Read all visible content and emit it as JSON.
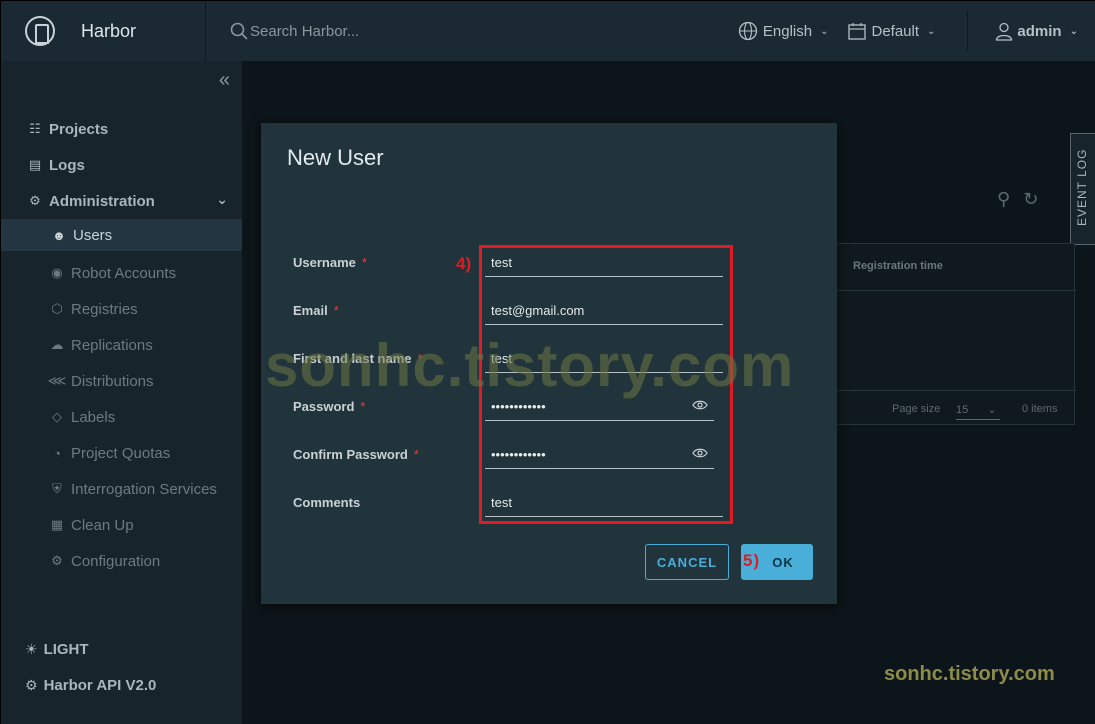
{
  "header": {
    "brand": "Harbor",
    "search_placeholder": "Search Harbor...",
    "language": "English",
    "theme_scope": "Default",
    "user": "admin"
  },
  "sidebar": {
    "items": [
      {
        "label": "Projects",
        "icon": "projects-icon",
        "level": "top"
      },
      {
        "label": "Logs",
        "icon": "logs-icon",
        "level": "top"
      },
      {
        "label": "Administration",
        "icon": "administration-icon",
        "level": "top"
      },
      {
        "label": "Users",
        "icon": "users-icon",
        "level": "sub",
        "active": true
      },
      {
        "label": "Robot Accounts",
        "icon": "robot-icon",
        "level": "sub"
      },
      {
        "label": "Registries",
        "icon": "registries-icon",
        "level": "sub"
      },
      {
        "label": "Replications",
        "icon": "replications-icon",
        "level": "sub"
      },
      {
        "label": "Distributions",
        "icon": "distributions-icon",
        "level": "sub"
      },
      {
        "label": "Labels",
        "icon": "labels-icon",
        "level": "sub"
      },
      {
        "label": "Project Quotas",
        "icon": "quotas-icon",
        "level": "sub"
      },
      {
        "label": "Interrogation Services",
        "icon": "shield-icon",
        "level": "sub"
      },
      {
        "label": "Clean Up",
        "icon": "trash-icon",
        "level": "sub"
      },
      {
        "label": "Configuration",
        "icon": "gear-icon",
        "level": "sub"
      }
    ],
    "theme_toggle": "LIGHT",
    "api_link": "Harbor API V2.0"
  },
  "background": {
    "event_log": "EVENT LOG",
    "table_header": "Registration time",
    "page_size_label": "Page size",
    "page_size_value": "15",
    "items_count": "0 items"
  },
  "modal": {
    "title": "New User",
    "fields": {
      "username": {
        "label": "Username",
        "value": "test"
      },
      "email": {
        "label": "Email",
        "value": "test@gmail.com"
      },
      "fullname": {
        "label": "First and last name",
        "value": "test"
      },
      "password": {
        "label": "Password",
        "value": "••••••••••••"
      },
      "confirm": {
        "label": "Confirm Password",
        "value": "••••••••••••"
      },
      "comments": {
        "label": "Comments",
        "value": "test"
      }
    },
    "required_mark": "*",
    "cancel_label": "CANCEL",
    "ok_label": "OK"
  },
  "annotations": {
    "step4": "4)",
    "step5": "5)",
    "highlight_color": "#e01b24"
  },
  "watermark": {
    "text": "sonhc.tistory.com"
  },
  "colors": {
    "accent": "#49afd9",
    "header_bg": "#1b2a32",
    "sidebar_bg": "#17242b",
    "modal_bg": "#21333b"
  }
}
